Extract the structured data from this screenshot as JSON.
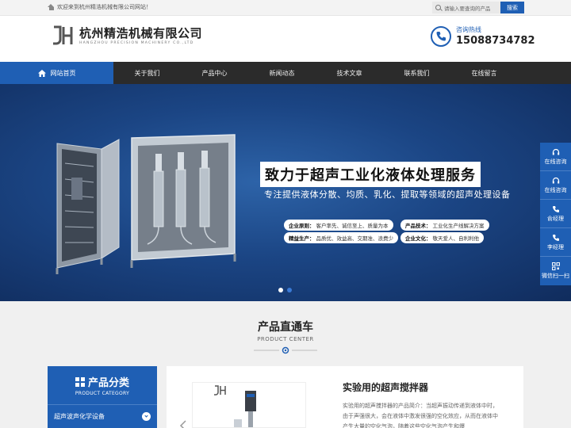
{
  "topbar": {
    "welcome": "欢迎来到杭州精浩机械有限公司网站！",
    "search_placeholder": "请输入要查询的产品",
    "search_button": "搜索"
  },
  "header": {
    "company_name": "杭州精浩机械有限公司",
    "company_en": "HANGZHOU PRECISION MACHINERY CO.,LTD",
    "hotline_label": "咨询热线",
    "hotline_number": "15088734782"
  },
  "nav": {
    "items": [
      {
        "label": "网站首页"
      },
      {
        "label": "关于我们"
      },
      {
        "label": "产品中心"
      },
      {
        "label": "新闻动态"
      },
      {
        "label": "技术文章"
      },
      {
        "label": "联系我们"
      },
      {
        "label": "在线留言"
      }
    ]
  },
  "banner": {
    "title": "致力于超声工业化液体处理服务",
    "subtitle": "专注提供液体分散、均质、乳化、提取等领域的超声处理设备",
    "pills": [
      {
        "key": "企业原则：",
        "value": "客户率先、诚信至上、质量为本"
      },
      {
        "key": "产品技术：",
        "value": "工业化生产线解决方案"
      },
      {
        "key": "精益生产：",
        "value": "品质优、效益高、交期准、浪费少"
      },
      {
        "key": "企业文化：",
        "value": "敬天爱人、自利利他"
      }
    ],
    "active_slide": 1,
    "slide_count": 2
  },
  "float_bar": {
    "items": [
      {
        "label": "在线咨询",
        "icon": "headset-icon"
      },
      {
        "label": "在线咨询",
        "icon": "headset-icon"
      },
      {
        "label": "俞经理",
        "icon": "phone-icon"
      },
      {
        "label": "李经理",
        "icon": "phone-icon"
      },
      {
        "label": "微信扫一扫",
        "icon": "qrcode-icon"
      }
    ]
  },
  "products": {
    "title": "产品直通车",
    "title_en": "PRODUCT CENTER",
    "category_title": "产品分类",
    "category_en": "PRODUCT CATEGORY",
    "category_first": "超声波声化学设备",
    "featured_title": "实验用的超声搅拌器",
    "featured_desc": "实验用的超声搅拌器的产品简介：当超声振动传递到液体中时，由于声强很大，会在液体中激发很强的空化效应，从而在液体中产生大量的空化气泡，随着这些空化气泡产生和爆"
  },
  "colors": {
    "brand": "#1f5fb4",
    "nav_bg": "#2b2b2b"
  }
}
